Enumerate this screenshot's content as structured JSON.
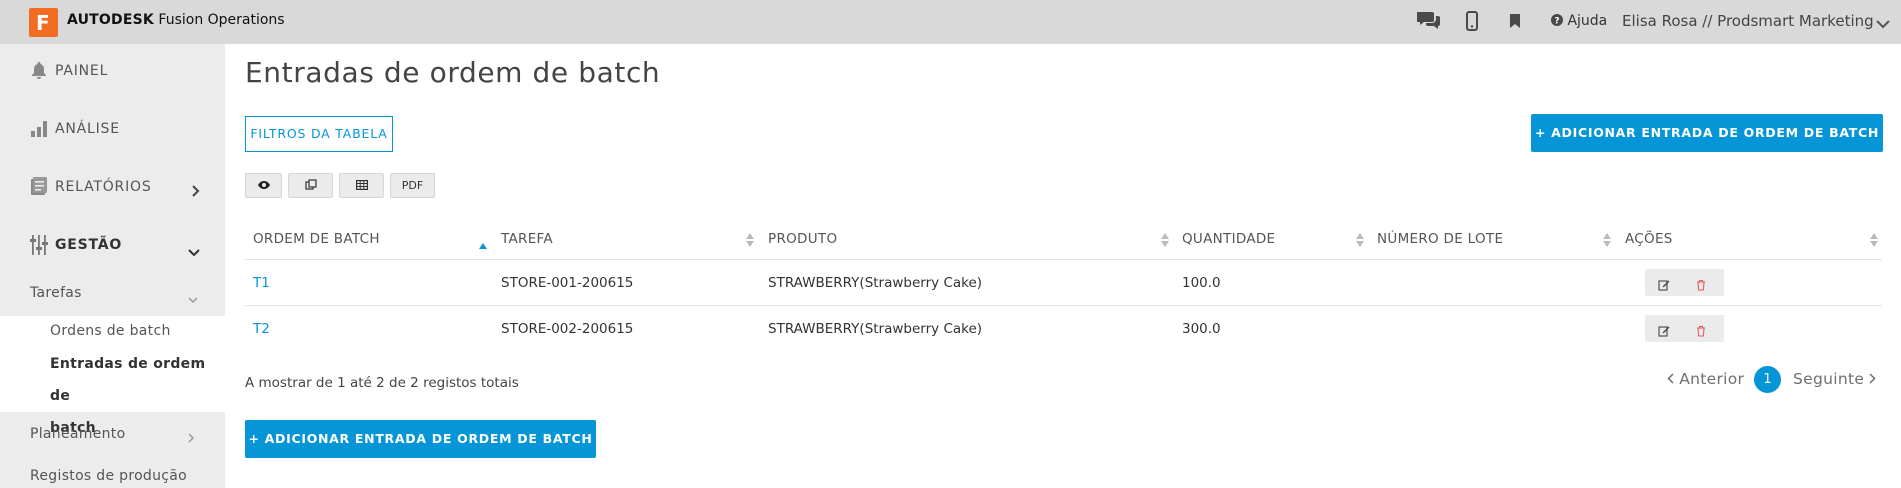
{
  "app": {
    "brand_bold": "AUTODESK",
    "brand_rest": " Fusion Operations",
    "logo_letter": "F",
    "help_label": "Ajuda",
    "user_label": "Elisa Rosa // Prodsmart Marketing",
    "accent_color": "#0696d7",
    "logo_color": "#f26c22"
  },
  "sidebar": {
    "items": [
      {
        "label": "PAINEL",
        "icon": "bell-icon"
      },
      {
        "label": "ANÁLISE",
        "icon": "bar-chart-icon"
      },
      {
        "label": "RELATÓRIOS",
        "icon": "report-icon"
      },
      {
        "label": "GESTÃO",
        "icon": "sliders-icon"
      }
    ],
    "tarefas": "Tarefas",
    "ordens": "Ordens de batch",
    "entradas_line1": "Entradas de ordem de",
    "entradas_line2": "batch",
    "planeamento": "Planeamento",
    "registos": "Registos de produção"
  },
  "main": {
    "title": "Entradas de ordem de batch",
    "filter_button": "FILTROS DA TABELA",
    "add_button": "+ ADICIONAR ENTRADA DE ORDEM DE BATCH",
    "pdf_label": "PDF",
    "columns": [
      "ORDEM DE BATCH",
      "TAREFA",
      "PRODUTO",
      "QUANTIDADE",
      "NÚMERO DE LOTE",
      "AÇÕES"
    ],
    "rows": [
      {
        "ordem": "T1",
        "tarefa": "STORE-001-200615",
        "produto": "STRAWBERRY(Strawberry Cake)",
        "quantidade": "100.0",
        "lote": ""
      },
      {
        "ordem": "T2",
        "tarefa": "STORE-002-200615",
        "produto": "STRAWBERRY(Strawberry Cake)",
        "quantidade": "300.0",
        "lote": ""
      }
    ],
    "showing": "A mostrar de 1 até 2 de 2 registos totais",
    "pagination": {
      "prev": "Anterior",
      "current": "1",
      "next": "Seguinte"
    }
  }
}
